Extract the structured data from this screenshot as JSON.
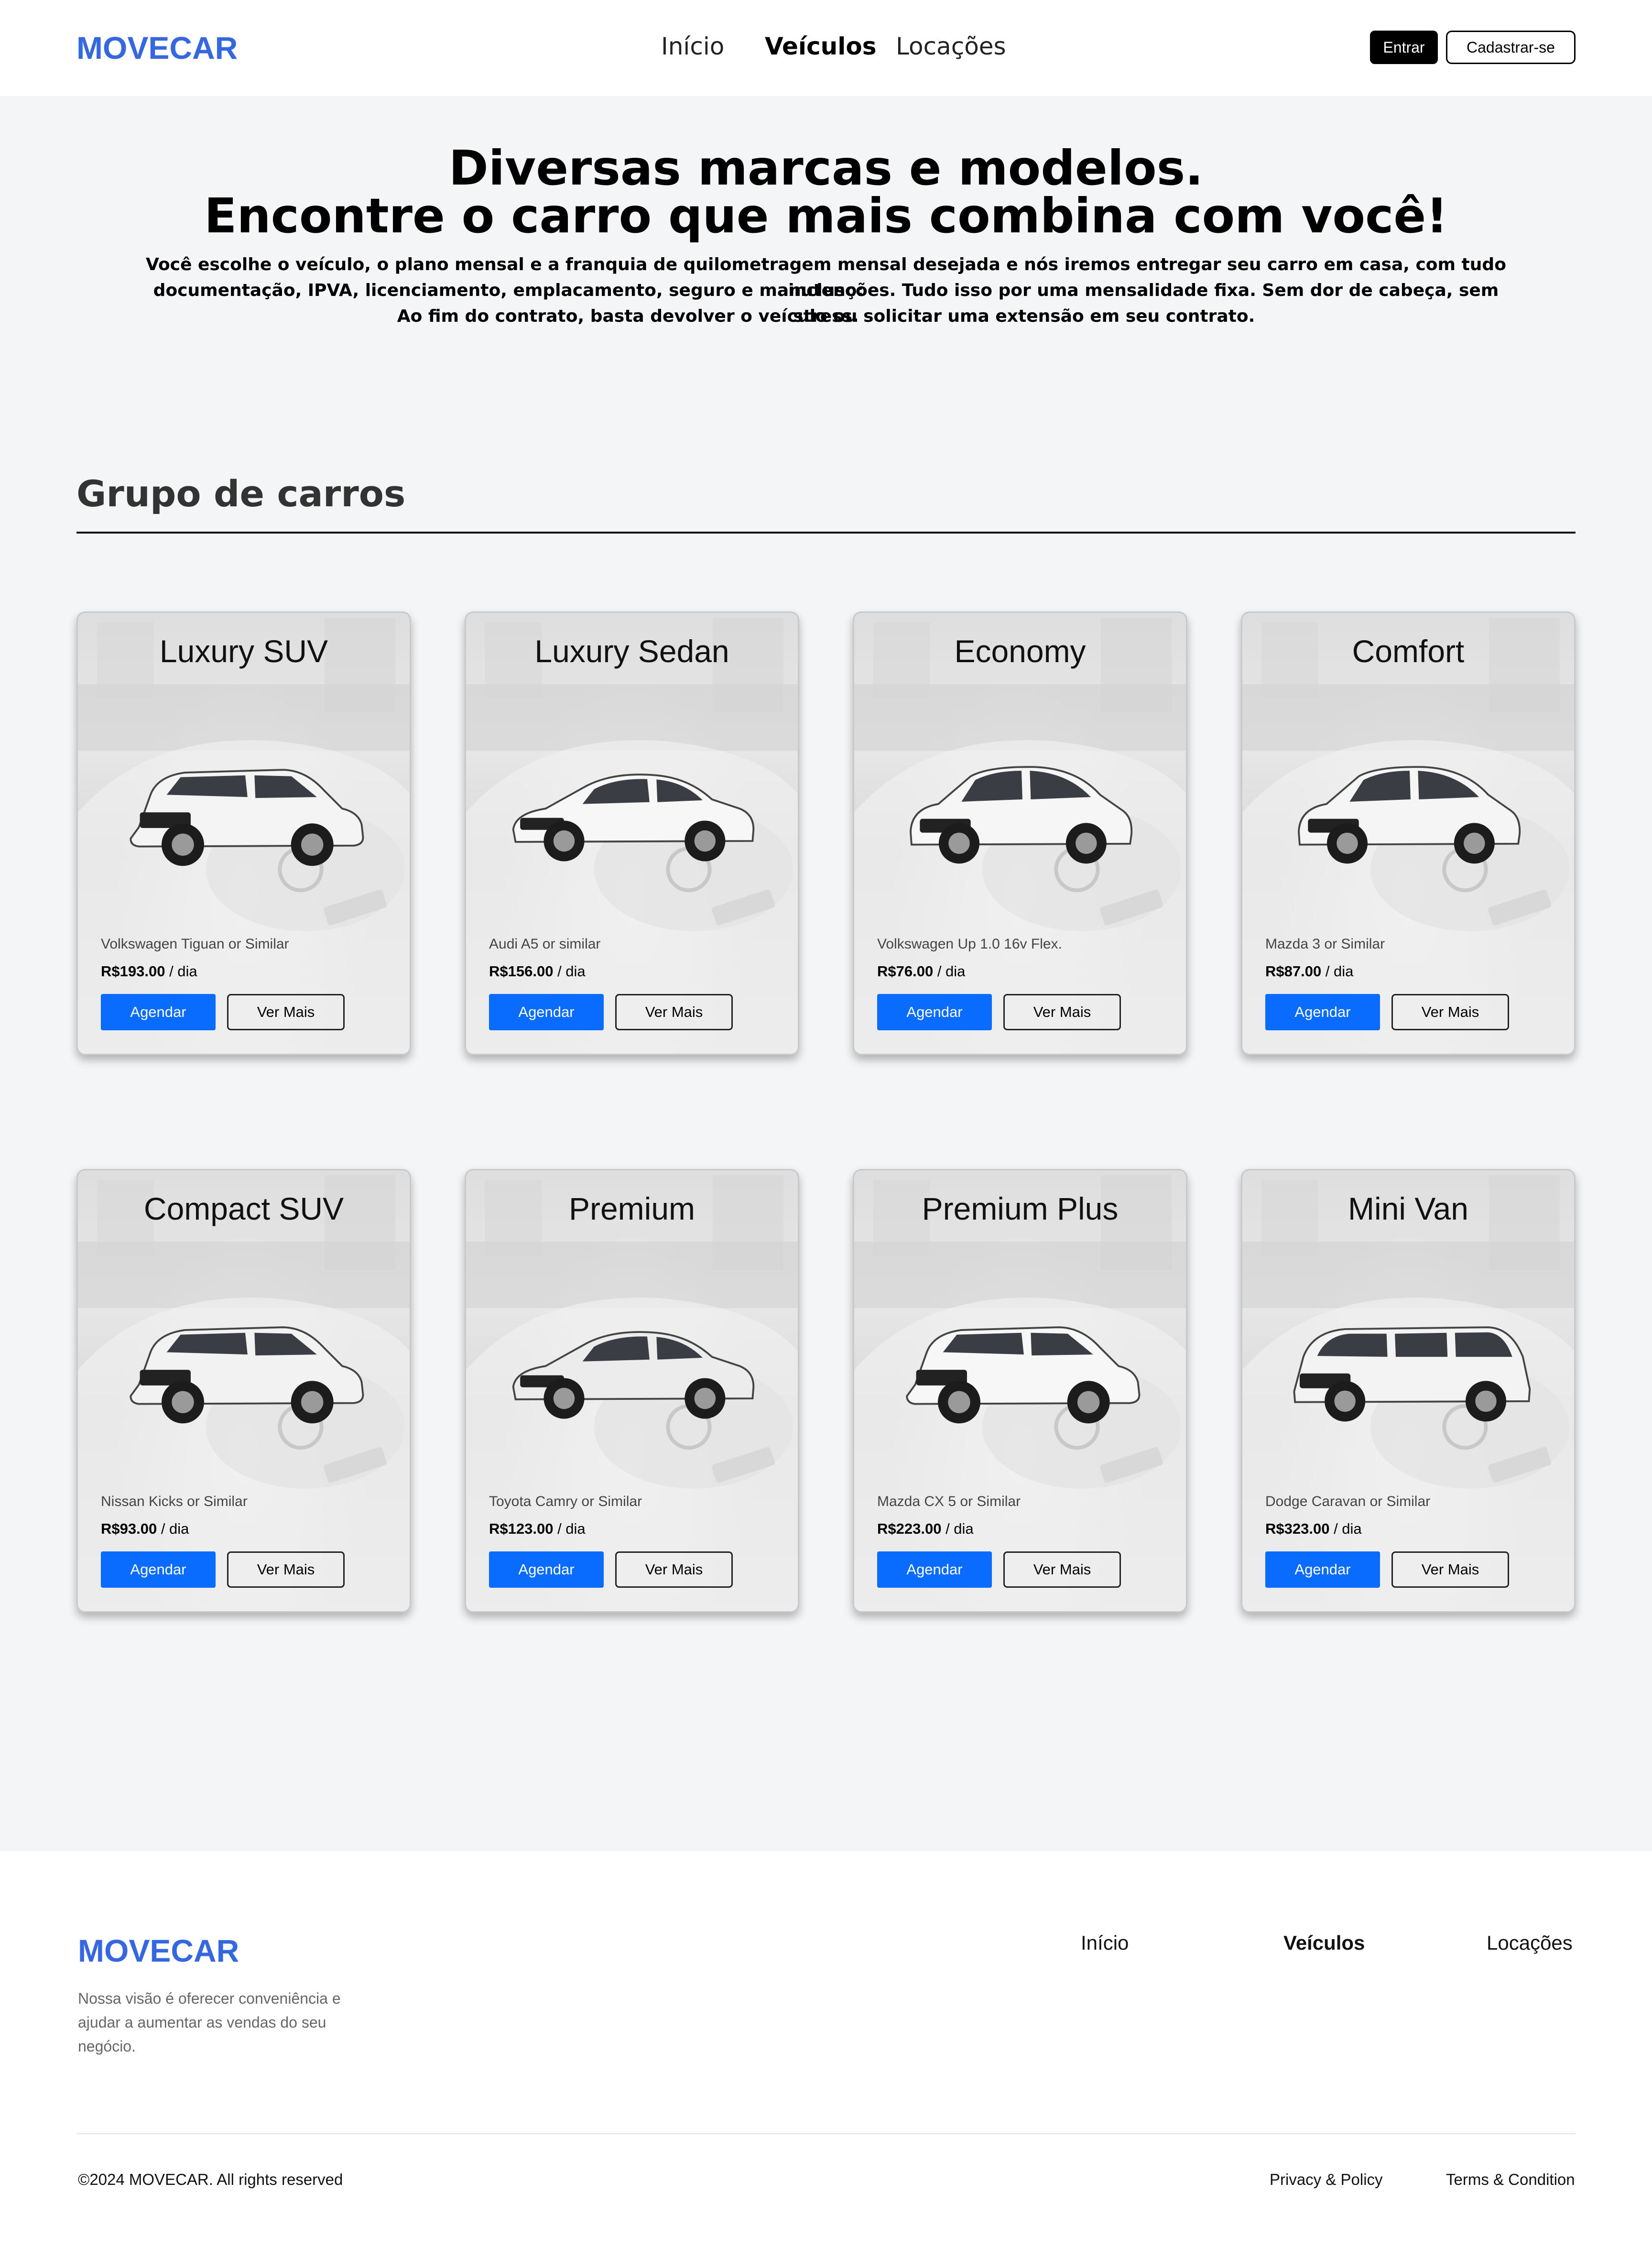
{
  "header": {
    "logo": "MOVECAR",
    "nav": [
      {
        "label": "Início",
        "active": false
      },
      {
        "label": "Veículos",
        "active": true
      },
      {
        "label": "Locações",
        "active": false
      }
    ],
    "login_label": "Entrar",
    "signup_label": "Cadastrar-se"
  },
  "hero": {
    "title_line1": "Diversas marcas e modelos.",
    "title_line2": "Encontre o carro que mais combina com você!",
    "desc_line1": "Você escolhe o veículo, o plano mensal e a franquia de quilometragem mensal desejada e nós iremos entregar seu carro em casa, com tudo incluso:",
    "desc_line2": "documentação, IPVA, licenciamento, emplacamento, seguro e manutenções. Tudo isso por uma mensalidade fixa. Sem dor de cabeça, sem stress.",
    "desc_line3": "Ao fim do contrato, basta devolver o veículo ou solicitar uma extensão em seu contrato."
  },
  "section": {
    "title": "Grupo de carros"
  },
  "cards": [
    {
      "name": "Luxury SUV",
      "model": "Volkswagen Tiguan or Similar",
      "price": "R$193.00",
      "unit": " / dia",
      "schedule_label": "Agendar",
      "more_label": "Ver Mais",
      "icon": "suv-icon",
      "color": "#f4f4f4"
    },
    {
      "name": "Luxury Sedan",
      "model": "Audi A5 or similar",
      "price": "R$156.00",
      "unit": " / dia",
      "schedule_label": "Agendar",
      "more_label": "Ver Mais",
      "icon": "sedan-icon",
      "color": "#f7f7f7"
    },
    {
      "name": "Economy",
      "model": "Volkswagen Up 1.0 16v Flex.",
      "price": "R$76.00",
      "unit": " / dia",
      "schedule_label": "Agendar",
      "more_label": "Ver Mais",
      "icon": "hatchback-icon",
      "color": "#f6f6f6"
    },
    {
      "name": "Comfort",
      "model": "Mazda 3 or Similar",
      "price": "R$87.00",
      "unit": " / dia",
      "schedule_label": "Agendar",
      "more_label": "Ver Mais",
      "icon": "hatchback-icon",
      "color": "#f5f5f5"
    },
    {
      "name": "Compact SUV",
      "model": "Nissan Kicks or Similar",
      "price": "R$93.00",
      "unit": " / dia",
      "schedule_label": "Agendar",
      "more_label": "Ver Mais",
      "icon": "suv-icon",
      "color": "#f2f2f2"
    },
    {
      "name": "Premium",
      "model": "Toyota Camry or Similar",
      "price": "R$123.00",
      "unit": " / dia",
      "schedule_label": "Agendar",
      "more_label": "Ver Mais",
      "icon": "sedan-icon",
      "color": "#ececec"
    },
    {
      "name": "Premium Plus",
      "model": "Mazda CX 5 or Similar",
      "price": "R$223.00",
      "unit": " / dia",
      "schedule_label": "Agendar",
      "more_label": "Ver Mais",
      "icon": "suv-icon",
      "color": "#f7f7f7"
    },
    {
      "name": "Mini Van",
      "model": "Dodge Caravan or Similar",
      "price": "R$323.00",
      "unit": " / dia",
      "schedule_label": "Agendar",
      "more_label": "Ver Mais",
      "icon": "minivan-icon",
      "color": "#f3f3f3"
    }
  ],
  "footer": {
    "logo": "MOVECAR",
    "tagline": "Nossa visão é oferecer conveniência e ajudar a aumentar as vendas do seu negócio.",
    "nav": [
      {
        "label": "Início",
        "active": false
      },
      {
        "label": "Veículos",
        "active": true
      },
      {
        "label": "Locações",
        "active": false
      }
    ],
    "copyright": "©2024 MOVECAR. All rights reserved",
    "privacy_label": "Privacy & Policy",
    "terms_label": "Terms & Condition"
  },
  "colors": {
    "brand": "#3568e0",
    "primary_button": "#0a6cff",
    "background": "#f4f5f7"
  }
}
